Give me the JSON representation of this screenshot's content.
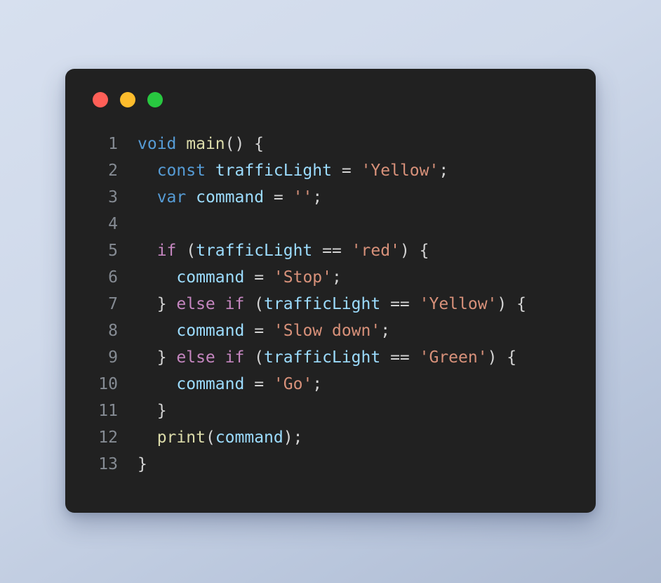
{
  "window": {
    "background_color": "#212121",
    "page_background_from": "#d7e0ef",
    "page_background_to": "#aebbd2",
    "traffic_lights": [
      {
        "name": "close",
        "color": "#ff5f57"
      },
      {
        "name": "minimize",
        "color": "#fdbc2c"
      },
      {
        "name": "maximize",
        "color": "#28c840"
      }
    ]
  },
  "editor": {
    "language": "dart",
    "line_number_color": "#858b93",
    "first_line_number": 1,
    "last_line_number": 13,
    "colors": {
      "keyword": "#569cd6",
      "control": "#c586c0",
      "function": "#dcdcaa",
      "identifier": "#9cdcfe",
      "string": "#d8917a",
      "punctuation": "#d4d4d4"
    },
    "lines": [
      {
        "n": "1",
        "text": "void main() {",
        "tokens": [
          {
            "t": "void",
            "c": "t-kw"
          },
          {
            "t": " ",
            "c": "t-pun"
          },
          {
            "t": "main",
            "c": "t-fn"
          },
          {
            "t": "() {",
            "c": "t-pun"
          }
        ]
      },
      {
        "n": "2",
        "text": "  const trafficLight = 'Yellow';",
        "tokens": [
          {
            "t": "  ",
            "c": "t-pun"
          },
          {
            "t": "const",
            "c": "t-kw"
          },
          {
            "t": " ",
            "c": "t-pun"
          },
          {
            "t": "trafficLight",
            "c": "t-var"
          },
          {
            "t": " ",
            "c": "t-pun"
          },
          {
            "t": "=",
            "c": "t-op"
          },
          {
            "t": " ",
            "c": "t-pun"
          },
          {
            "t": "'Yellow'",
            "c": "t-str"
          },
          {
            "t": ";",
            "c": "t-pun"
          }
        ]
      },
      {
        "n": "3",
        "text": "  var command = '';",
        "tokens": [
          {
            "t": "  ",
            "c": "t-pun"
          },
          {
            "t": "var",
            "c": "t-kw"
          },
          {
            "t": " ",
            "c": "t-pun"
          },
          {
            "t": "command",
            "c": "t-var"
          },
          {
            "t": " ",
            "c": "t-pun"
          },
          {
            "t": "=",
            "c": "t-op"
          },
          {
            "t": " ",
            "c": "t-pun"
          },
          {
            "t": "''",
            "c": "t-str"
          },
          {
            "t": ";",
            "c": "t-pun"
          }
        ]
      },
      {
        "n": "4",
        "text": "",
        "tokens": []
      },
      {
        "n": "5",
        "text": "  if (trafficLight == 'red') {",
        "tokens": [
          {
            "t": "  ",
            "c": "t-pun"
          },
          {
            "t": "if",
            "c": "t-ctl"
          },
          {
            "t": " (",
            "c": "t-pun"
          },
          {
            "t": "trafficLight",
            "c": "t-var"
          },
          {
            "t": " ",
            "c": "t-pun"
          },
          {
            "t": "==",
            "c": "t-op"
          },
          {
            "t": " ",
            "c": "t-pun"
          },
          {
            "t": "'red'",
            "c": "t-str"
          },
          {
            "t": ") {",
            "c": "t-pun"
          }
        ]
      },
      {
        "n": "6",
        "text": "    command = 'Stop';",
        "tokens": [
          {
            "t": "    ",
            "c": "t-pun"
          },
          {
            "t": "command",
            "c": "t-var"
          },
          {
            "t": " ",
            "c": "t-pun"
          },
          {
            "t": "=",
            "c": "t-op"
          },
          {
            "t": " ",
            "c": "t-pun"
          },
          {
            "t": "'Stop'",
            "c": "t-str"
          },
          {
            "t": ";",
            "c": "t-pun"
          }
        ]
      },
      {
        "n": "7",
        "text": "  } else if (trafficLight == 'Yellow') {",
        "tokens": [
          {
            "t": "  } ",
            "c": "t-pun"
          },
          {
            "t": "else if",
            "c": "t-ctl"
          },
          {
            "t": " (",
            "c": "t-pun"
          },
          {
            "t": "trafficLight",
            "c": "t-var"
          },
          {
            "t": " ",
            "c": "t-pun"
          },
          {
            "t": "==",
            "c": "t-op"
          },
          {
            "t": " ",
            "c": "t-pun"
          },
          {
            "t": "'Yellow'",
            "c": "t-str"
          },
          {
            "t": ") {",
            "c": "t-pun"
          }
        ]
      },
      {
        "n": "8",
        "text": "    command = 'Slow down';",
        "tokens": [
          {
            "t": "    ",
            "c": "t-pun"
          },
          {
            "t": "command",
            "c": "t-var"
          },
          {
            "t": " ",
            "c": "t-pun"
          },
          {
            "t": "=",
            "c": "t-op"
          },
          {
            "t": " ",
            "c": "t-pun"
          },
          {
            "t": "'Slow down'",
            "c": "t-str"
          },
          {
            "t": ";",
            "c": "t-pun"
          }
        ]
      },
      {
        "n": "9",
        "text": "  } else if (trafficLight == 'Green') {",
        "tokens": [
          {
            "t": "  } ",
            "c": "t-pun"
          },
          {
            "t": "else if",
            "c": "t-ctl"
          },
          {
            "t": " (",
            "c": "t-pun"
          },
          {
            "t": "trafficLight",
            "c": "t-var"
          },
          {
            "t": " ",
            "c": "t-pun"
          },
          {
            "t": "==",
            "c": "t-op"
          },
          {
            "t": " ",
            "c": "t-pun"
          },
          {
            "t": "'Green'",
            "c": "t-str"
          },
          {
            "t": ") {",
            "c": "t-pun"
          }
        ]
      },
      {
        "n": "10",
        "text": "    command = 'Go';",
        "tokens": [
          {
            "t": "    ",
            "c": "t-pun"
          },
          {
            "t": "command",
            "c": "t-var"
          },
          {
            "t": " ",
            "c": "t-pun"
          },
          {
            "t": "=",
            "c": "t-op"
          },
          {
            "t": " ",
            "c": "t-pun"
          },
          {
            "t": "'Go'",
            "c": "t-str"
          },
          {
            "t": ";",
            "c": "t-pun"
          }
        ]
      },
      {
        "n": "11",
        "text": "  }",
        "tokens": [
          {
            "t": "  }",
            "c": "t-pun"
          }
        ]
      },
      {
        "n": "12",
        "text": "  print(command);",
        "tokens": [
          {
            "t": "  ",
            "c": "t-pun"
          },
          {
            "t": "print",
            "c": "t-fn"
          },
          {
            "t": "(",
            "c": "t-pun"
          },
          {
            "t": "command",
            "c": "t-var"
          },
          {
            "t": ");",
            "c": "t-pun"
          }
        ]
      },
      {
        "n": "13",
        "text": "}",
        "tokens": [
          {
            "t": "}",
            "c": "t-pun"
          }
        ]
      }
    ]
  }
}
